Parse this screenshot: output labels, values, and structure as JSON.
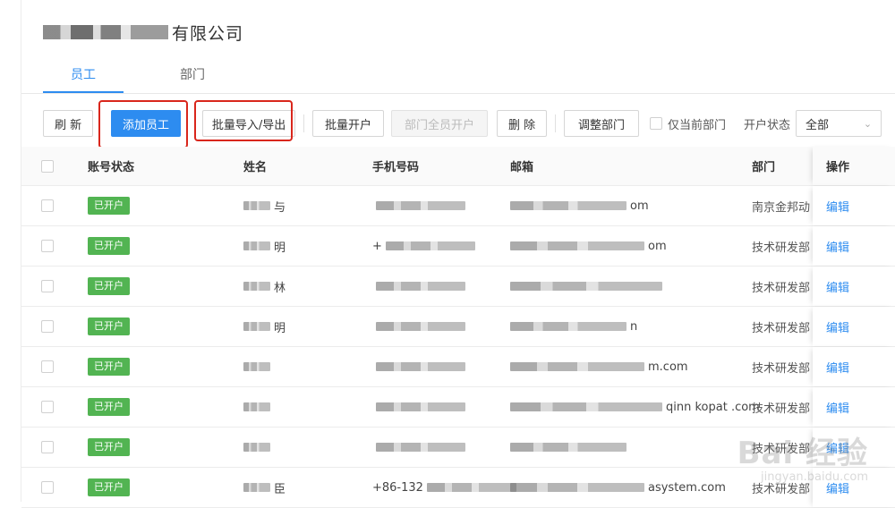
{
  "company": {
    "name_visible": "有限公司"
  },
  "tabs": [
    {
      "label": "员工",
      "active": true
    },
    {
      "label": "部门",
      "active": false
    }
  ],
  "toolbar": {
    "refresh": "刷 新",
    "add_employee": "添加员工",
    "batch_import_export": "批量导入/导出",
    "batch_open": "批量开户",
    "dept_all_open": "部门全员开户",
    "delete": "删 除",
    "adjust_dept": "调整部门",
    "current_dept_only": "仅当前部门",
    "open_status_label": "开户状态",
    "open_status_value": "全部"
  },
  "table": {
    "columns": {
      "status": "账号状态",
      "name": "姓名",
      "phone": "手机号码",
      "email": "邮箱",
      "dept": "部门",
      "op": "操作"
    },
    "rows": [
      {
        "status": "已开户",
        "name_tail": "与",
        "phone_head": "",
        "email_tail": "om",
        "dept": "南京金邦动",
        "op": "编辑"
      },
      {
        "status": "已开户",
        "name_tail": "明",
        "phone_head": "+",
        "email_tail": "om",
        "dept": "技术研发部",
        "op": "编辑"
      },
      {
        "status": "已开户",
        "name_tail": "林",
        "phone_head": "",
        "email_tail": "",
        "dept": "技术研发部",
        "op": "编辑"
      },
      {
        "status": "已开户",
        "name_tail": "明",
        "phone_head": "",
        "email_tail": "n",
        "dept": "技术研发部",
        "op": "编辑"
      },
      {
        "status": "已开户",
        "name_tail": "",
        "phone_head": "",
        "email_tail": "m.com",
        "dept": "技术研发部",
        "op": "编辑"
      },
      {
        "status": "已开户",
        "name_tail": "",
        "phone_head": "",
        "email_tail": "qinn  kopat  .com",
        "dept": "技术研发部",
        "op": "编辑"
      },
      {
        "status": "已开户",
        "name_tail": "",
        "phone_head": "",
        "email_tail": "",
        "dept": "技术研发部",
        "op": "编辑"
      },
      {
        "status": "已开户",
        "name_tail": "臣",
        "phone_head": "+86-132",
        "email_tail": "asystem.com",
        "dept": "技术研发部",
        "op": "编辑"
      }
    ]
  },
  "watermark": {
    "main": "Bai 经验",
    "sub": "jingyan.baidu.com"
  },
  "colors": {
    "primary": "#2d8cf0",
    "success": "#52b452",
    "highlight": "#d9261c"
  }
}
